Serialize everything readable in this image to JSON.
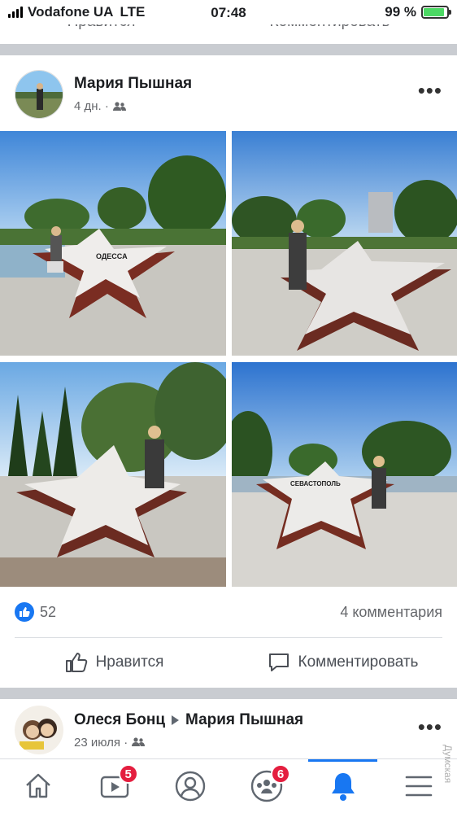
{
  "status_bar": {
    "carrier": "Vodafone UA",
    "network": "LTE",
    "time": "07:48",
    "battery": "99 %"
  },
  "previous_post": {
    "like_label": "Нравится",
    "comment_label": "Комментировать"
  },
  "post": {
    "author": "Мария Пышная",
    "time_ago": "4 дн. ·",
    "audience_icon": "friends-icon",
    "more_icon": "more-dots-icon",
    "more_label": "•••",
    "photos": [
      {
        "caption": "ОДЕССА"
      },
      {
        "caption": ""
      },
      {
        "caption": ""
      },
      {
        "caption": "СЕВАСТОПОЛЬ"
      }
    ],
    "reactions": {
      "like_count": "52",
      "comments": "4 комментария"
    },
    "actions": {
      "like": "Нравится",
      "comment": "Комментировать"
    }
  },
  "next_post": {
    "author": "Олеся Бонц",
    "target": "Мария Пышная",
    "date": "23 июля ·",
    "more_label": "•••"
  },
  "bottom_nav": {
    "items": [
      {
        "name": "home-icon",
        "badge": ""
      },
      {
        "name": "video-icon",
        "badge": "5"
      },
      {
        "name": "profile-icon",
        "badge": ""
      },
      {
        "name": "groups-icon",
        "badge": "6"
      },
      {
        "name": "notifications-icon",
        "badge": ""
      },
      {
        "name": "menu-icon",
        "badge": ""
      }
    ],
    "active_index": 4
  },
  "watermark": "Думская",
  "colors": {
    "accent": "#1877f2",
    "badge": "#e41e3f",
    "separator": "#c9ccd1"
  }
}
